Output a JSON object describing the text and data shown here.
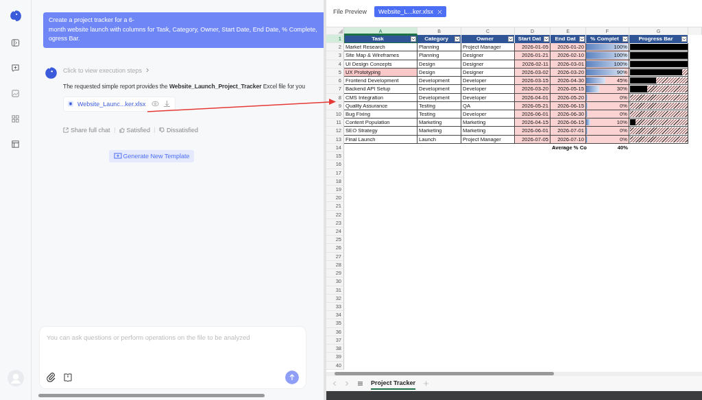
{
  "chat": {
    "user_message": [
      "Create a project tracker for a 6-",
      "month website launch with columns for Task, Category, Owner, Start Date, End Date, % Complete,",
      "ogress Bar."
    ],
    "steps_link": "Click to view execution steps",
    "answer": "The requested simple report provides the **Website_Launch_Project_Tracker** Excel file for you",
    "file_name": "Website_Launc...ker.xlsx",
    "actions": [
      "Share full chat",
      "Satisfied",
      "Dissatisfied"
    ],
    "template_button": "Generate New Template",
    "input": {
      "placeholder": "You can ask questions or perform operations on the file to be analyzed"
    }
  },
  "preview": {
    "title": "File Preview",
    "tab": "Website_L...ker.xlsx"
  },
  "sheet": {
    "columns": [
      {
        "label": "A",
        "selected": true
      },
      {
        "label": "B",
        "selected": false
      },
      {
        "label": "C",
        "selected": false
      },
      {
        "label": "D",
        "selected": false
      },
      {
        "label": "E",
        "selected": false
      },
      {
        "label": "F",
        "selected": false
      },
      {
        "label": "G",
        "selected": false
      }
    ],
    "headers": [
      "Task",
      "Category",
      "Owner",
      "Start Dat",
      "End Dat",
      "% Complet",
      "Progress Bar"
    ],
    "rows": [
      {
        "task": "Market Research",
        "category": "Planning",
        "owner": "Project Manager",
        "start": "2026-01-05",
        "end": "2026-01-20",
        "percent": "100%",
        "level": 1,
        "highlighted": false
      },
      {
        "task": "Site Map & Wireframes",
        "category": "Planning",
        "owner": "Designer",
        "start": "2026-01-21",
        "end": "2026-02-10",
        "percent": "100%",
        "level": 1,
        "highlighted": false
      },
      {
        "task": "UI Design Concepts",
        "category": "Design",
        "owner": "Designer",
        "start": "2026-02-11",
        "end": "2026-03-01",
        "percent": "100%",
        "level": 1,
        "highlighted": false
      },
      {
        "task": "UX Prototyping",
        "category": "Design",
        "owner": "Designer",
        "start": "2026-03-02",
        "end": "2026-03-20",
        "percent": "90%",
        "level": 0.9,
        "highlighted": true
      },
      {
        "task": "Frontend Development",
        "category": "Development",
        "owner": "Developer",
        "start": "2026-03-15",
        "end": "2026-04-30",
        "percent": "45%",
        "level": 0.45,
        "highlighted": false
      },
      {
        "task": "Backend API Setup",
        "category": "Development",
        "owner": "Developer",
        "start": "2026-03-20",
        "end": "2026-05-15",
        "percent": "30%",
        "level": 0.3,
        "highlighted": false
      },
      {
        "task": "CMS Integration",
        "category": "Development",
        "owner": "Developer",
        "start": "2026-04-01",
        "end": "2026-05-20",
        "percent": "0%",
        "level": 0,
        "highlighted": false
      },
      {
        "task": "Quality Assurance",
        "category": "Testing",
        "owner": "QA",
        "start": "2026-05-21",
        "end": "2026-06-15",
        "percent": "0%",
        "level": 0,
        "highlighted": false
      },
      {
        "task": "Bug Fixing",
        "category": "Testing",
        "owner": "Developer",
        "start": "2026-06-01",
        "end": "2026-06-30",
        "percent": "0%",
        "level": 0,
        "highlighted": false
      },
      {
        "task": "Content Population",
        "category": "Marketing",
        "owner": "Marketing",
        "start": "2026-04-15",
        "end": "2026-06-15",
        "percent": "10%",
        "level": 0.1,
        "highlighted": false
      },
      {
        "task": "SEO Strategy",
        "category": "Marketing",
        "owner": "Marketing",
        "start": "2026-06-01",
        "end": "2026-07-01",
        "percent": "0%",
        "level": 0,
        "highlighted": false
      },
      {
        "task": "Final Launch",
        "category": "Launch",
        "owner": "Project Manager",
        "start": "2026-07-05",
        "end": "2026-07-10",
        "percent": "0%",
        "level": 0,
        "highlighted": false
      }
    ],
    "summary": {
      "label": "Average % Co",
      "value": "40%"
    },
    "row_numbers": [
      "1",
      "2",
      "3",
      "4",
      "5",
      "6",
      "7",
      "8",
      "9",
      "10",
      "11",
      "12",
      "13",
      "14",
      "15",
      "16",
      "17",
      "18",
      "19",
      "20",
      "21",
      "22",
      "23",
      "24",
      "25",
      "26",
      "27",
      "28",
      "29",
      "30",
      "31",
      "32",
      "33",
      "34",
      "35",
      "36",
      "37",
      "38",
      "39",
      "40"
    ],
    "sheet_tab": "Project Tracker"
  }
}
